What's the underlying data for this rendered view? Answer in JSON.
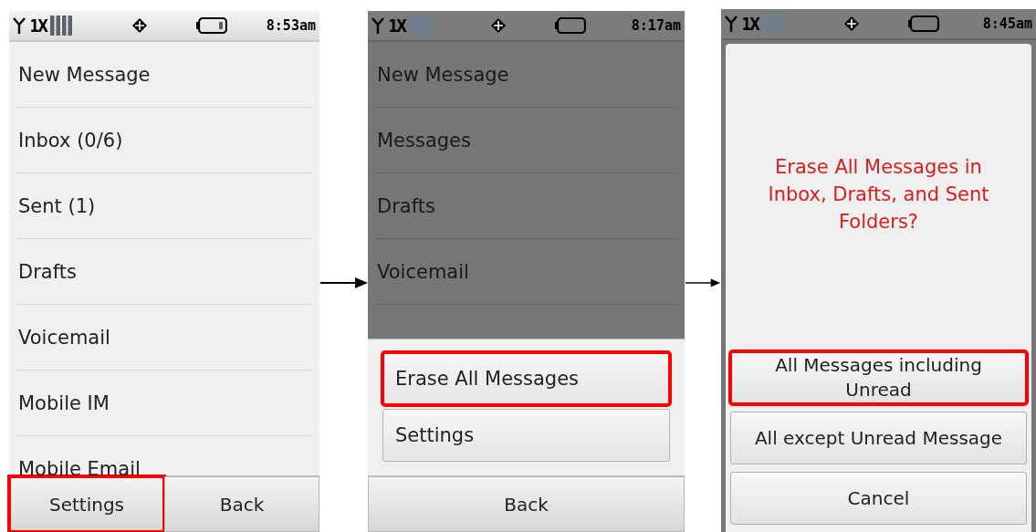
{
  "screens": [
    {
      "status": {
        "network": "1X",
        "time": "8:53am"
      },
      "dimmed": false,
      "menu": [
        {
          "label": "New Message"
        },
        {
          "label": "Inbox (0/6)"
        },
        {
          "label": "Sent (1)"
        },
        {
          "label": "Drafts"
        },
        {
          "label": "Voicemail"
        },
        {
          "label": "Mobile IM"
        },
        {
          "label": "Mobile Email"
        }
      ],
      "softkeys": [
        {
          "label": "Settings",
          "highlighted": true
        },
        {
          "label": "Back",
          "highlighted": false
        }
      ]
    },
    {
      "status": {
        "network": "1X",
        "time": "8:17am"
      },
      "dimmed": true,
      "menu": [
        {
          "label": "New Message"
        },
        {
          "label": "Messages"
        },
        {
          "label": "Drafts"
        },
        {
          "label": "Voicemail"
        }
      ],
      "popup": {
        "options": [
          {
            "label": "Erase All Messages",
            "highlighted": true
          },
          {
            "label": "Settings",
            "highlighted": false
          }
        ]
      },
      "softkeys": [
        {
          "label": "Back",
          "highlighted": false
        }
      ]
    },
    {
      "status": {
        "network": "1X",
        "time": "8:45am"
      },
      "dimmed": true,
      "dialog": {
        "message": "Erase All Messages in Inbox, Drafts, and Sent Folders?",
        "options": [
          {
            "label": "All Messages including Unread",
            "highlighted": true
          },
          {
            "label": "All except Unread Message",
            "highlighted": false
          },
          {
            "label": "Cancel",
            "highlighted": false
          }
        ]
      }
    }
  ]
}
